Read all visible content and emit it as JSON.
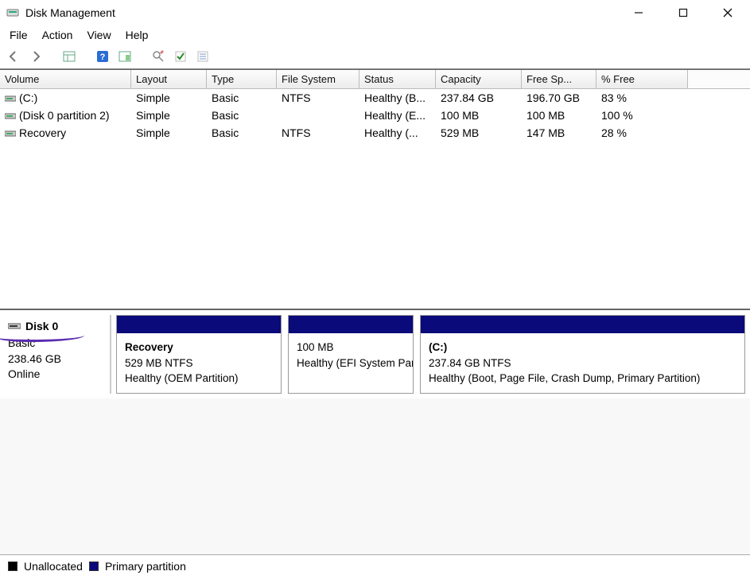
{
  "window": {
    "title": "Disk Management"
  },
  "menu": {
    "file": "File",
    "action": "Action",
    "view": "View",
    "help": "Help"
  },
  "columns": {
    "volume": "Volume",
    "layout": "Layout",
    "type": "Type",
    "fs": "File System",
    "status": "Status",
    "capacity": "Capacity",
    "free": "Free Sp...",
    "pct": "% Free"
  },
  "volumes": [
    {
      "name": "(C:)",
      "layout": "Simple",
      "type": "Basic",
      "fs": "NTFS",
      "status": "Healthy (B...",
      "capacity": "237.84 GB",
      "free": "196.70 GB",
      "pct": "83 %"
    },
    {
      "name": "(Disk 0 partition 2)",
      "layout": "Simple",
      "type": "Basic",
      "fs": "",
      "status": "Healthy (E...",
      "capacity": "100 MB",
      "free": "100 MB",
      "pct": "100 %"
    },
    {
      "name": "Recovery",
      "layout": "Simple",
      "type": "Basic",
      "fs": "NTFS",
      "status": "Healthy (...",
      "capacity": "529 MB",
      "free": "147 MB",
      "pct": "28 %"
    }
  ],
  "disk": {
    "name": "Disk 0",
    "type": "Basic",
    "size": "238.46 GB",
    "state": "Online"
  },
  "partitions": [
    {
      "name": "Recovery",
      "size_line": "529 MB NTFS",
      "status_line": "Healthy (OEM Partition)"
    },
    {
      "name": "",
      "size_line": "100 MB",
      "status_line": "Healthy (EFI System Partition)"
    },
    {
      "name": "(C:)",
      "size_line": "237.84 GB NTFS",
      "status_line": "Healthy (Boot, Page File, Crash Dump, Primary Partition)"
    }
  ],
  "legend": {
    "unallocated": "Unallocated",
    "primary": "Primary partition"
  },
  "colors": {
    "partition_header": "#0a0a7a",
    "annotation": "#5a2db0"
  }
}
